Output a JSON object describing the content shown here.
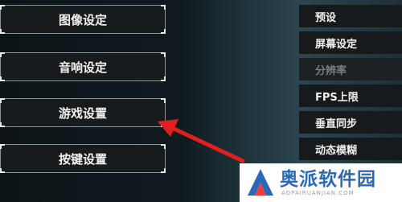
{
  "left_menu": {
    "items": [
      {
        "label": "图像设定"
      },
      {
        "label": "音响设定"
      },
      {
        "label": "游戏设置"
      },
      {
        "label": "按键设置"
      }
    ]
  },
  "right_menu": {
    "items": [
      {
        "label": "预设",
        "disabled": false
      },
      {
        "label": "屏幕设定",
        "disabled": false
      },
      {
        "label": "分辨率",
        "disabled": true
      },
      {
        "label": "FPS上限",
        "disabled": false
      },
      {
        "label": "垂直同步",
        "disabled": false
      },
      {
        "label": "动态模糊",
        "disabled": false
      }
    ]
  },
  "watermark": {
    "title": "奥派软件园",
    "url": "AOPAIRUANJIAN.COM"
  },
  "annotation": {
    "arrow_color": "#e0201e",
    "arrow_target": "游戏设置"
  },
  "colors": {
    "button_bg": "#181b1e",
    "button_border": "#8c9499",
    "disabled_text": "#777c80",
    "watermark_blue": "#2b69b8"
  }
}
